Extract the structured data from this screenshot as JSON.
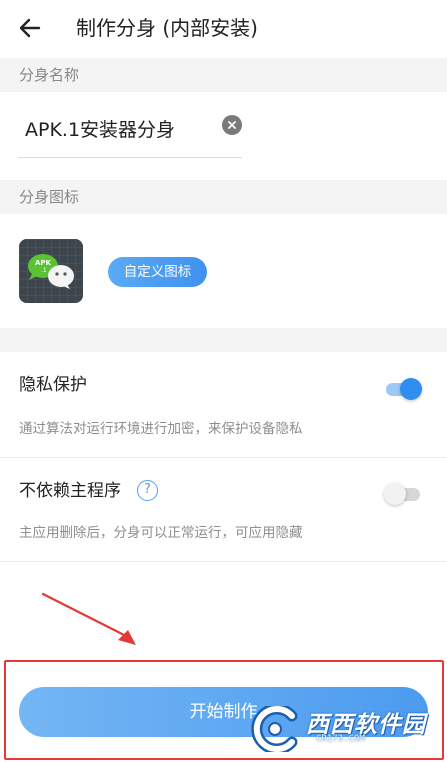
{
  "header": {
    "title": "制作分身 (内部安装)",
    "back_icon": "arrow-left-icon"
  },
  "name_section": {
    "label": "分身名称",
    "value": "APK.1安装器分身",
    "clear_icon": "clear-circle-icon"
  },
  "icon_section": {
    "label": "分身图标",
    "app_icon_text": "APK",
    "app_icon_subtext": ".1",
    "custom_button_label": "自定义图标"
  },
  "settings": {
    "privacy": {
      "title": "隐私保护",
      "description": "通过算法对运行环境进行加密，来保护设备隐私",
      "enabled": true
    },
    "independent": {
      "title": "不依赖主程序",
      "help_glyph": "?",
      "description": "主应用删除后，分身可以正常运行，可应用隐藏",
      "enabled": false
    }
  },
  "start_button_label": "开始制作",
  "watermark": {
    "text": "西西软件园",
    "subtext": "CR173.COM"
  },
  "colors": {
    "accent": "#2f8ef0",
    "annotation_red": "#e53935"
  }
}
